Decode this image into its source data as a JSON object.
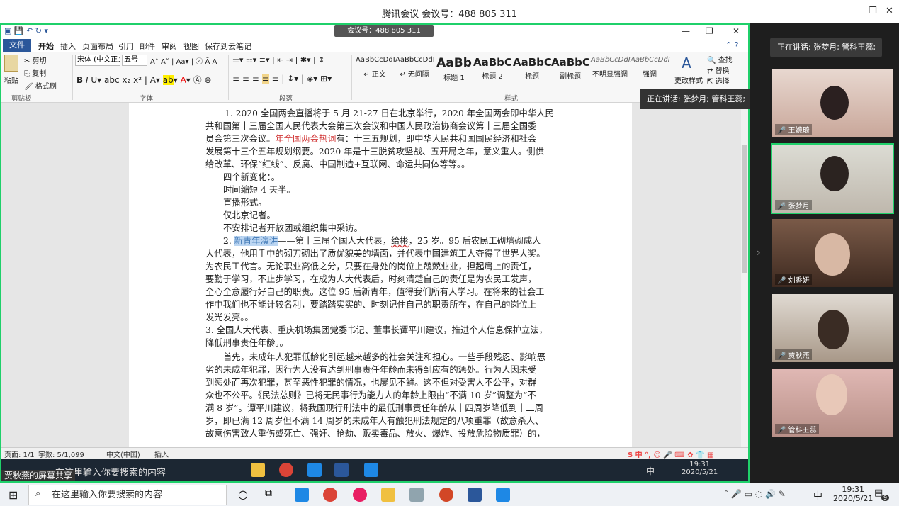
{
  "meeting": {
    "title": "腾讯会议 会议号：488 805 311",
    "float_label": "会议号：488 805 311",
    "speaking": "正在讲话: 张梦月; 管科王蕊;",
    "share_caption": "贾秋燕的屏幕共享"
  },
  "word": {
    "tabs": [
      "文件",
      "开始",
      "插入",
      "页面布局",
      "引用",
      "邮件",
      "审阅",
      "视图",
      "保存到云笔记"
    ],
    "clipboard": {
      "cut": "剪切",
      "copy": "复制",
      "paste": "粘贴",
      "format": "格式刷",
      "group": "剪贴板"
    },
    "font": {
      "name": "宋体 (中文正文)",
      "size": "五号",
      "group": "字体"
    },
    "paragraph_group": "段落",
    "styles_group": "样式",
    "styles": [
      {
        "sample": "AaBbCcDdI",
        "name": "↵ 正文"
      },
      {
        "sample": "AaBbCcDdI",
        "name": "↵ 无间隔"
      },
      {
        "sample": "AaBb",
        "name": "标题 1"
      },
      {
        "sample": "AaBbC",
        "name": "标题 2"
      },
      {
        "sample": "AaBbC",
        "name": "标题"
      },
      {
        "sample": "AaBbC",
        "name": "副标题"
      },
      {
        "sample": "AaBbCcDdI",
        "name": "不明显强调"
      },
      {
        "sample": "AaBbCcDdI",
        "name": "强调"
      }
    ],
    "change_styles": "更改样式",
    "edit": {
      "find": "查找",
      "replace": "替换",
      "select": "选择"
    },
    "status": {
      "page": "页面: 1/1",
      "words": "字数: 5/1,099",
      "lang": "中文(中国)",
      "mode": "插入"
    }
  },
  "doc": {
    "lines": [
      "1.   2020 全国两会直播将于 5 月 21-27 日在北京举行，2020 年全国两会即中华人民",
      "共和国第十三届全国人民代表大会第三次会议和中国人民政治协商会议第十三届全国委",
      "员会第三次会议。",
      "年全国两会热词",
      "有：十三五规划，即中华人民共和国国民经济和社会",
      "发展第十三个五年规划纲要。2020 年是十三脱贫攻坚战、五开局之年，意义重大。侧供",
      "给改革、环保“红线”、反腐、中国制造+互联网、命运共同体等等。。",
      "四个新变化：。",
      "时间缩短 4 天半。",
      "直播形式。",
      "仅北京记者。",
      "不安排记者开放团或组织集中采访。",
      "2.",
      "新青年演讲",
      "——第十三届全国人大代表，",
      "给彬",
      "，25 岁。95 后农民工砌墙砌成人",
      "大代表，他用手中的砌刀砌出了质优貌美的墙面，并代表中国建筑工人夺得了世界大奖。",
      "为农民工代言。无论职业高低之分，只要在身处的岗位上兢兢业业，担起肩上的责任，",
      "要勤于学习，不止步学习，在成为人大代表后，时刻清楚自己的责任是为农民工发声，",
      "全心全意履行好自己的职责。这位 95 后新青年，值得我们所有人学习。在将来的社会工",
      "作中我们也不能计较名利，要踏踏实实的、时刻记住自己的职责所在，在自己的岗位上",
      "发光发亮。。",
      "3. 全国人大代表、重庆机场集团党委书记、董事长谭平川建议，推进个人信息保护立法，",
      "降低刑事责任年龄。。",
      "首先，未成年人犯罪低龄化引起越来越多的社会关注和担心。一些手段残忍、影响恶",
      "劣的未成年犯罪，因行为人没有达到刑事责任年龄而未得到应有的惩处。行为人因未受",
      "到惩处而再次犯罪，甚至恶性犯罪的情况，也屡见不鲜。这不但对受害人不公平，对群",
      "众也不公平。《民法总则》已将无民事行为能力人的年龄上限由“不满 10 岁”调整为“不",
      "满 8 岁”。谭平川建议，将我国现行刑法中的最低刑事责任年龄从十四周岁降低到十二周",
      "岁，即已满 12 周岁但不满 14 周岁的未成年人有触犯刑法规定的八项重罪（故意杀人、",
      "故意伤害致人重伤或死亡、强奸、抢劫、贩卖毒品、放火、爆炸、投放危险物质罪）的，"
    ]
  },
  "participants": [
    {
      "name": "王婉琦"
    },
    {
      "name": "张梦月"
    },
    {
      "name": "刘香妍"
    },
    {
      "name": "贾秋燕"
    },
    {
      "name": "管科王蕊"
    }
  ],
  "remote_taskbar": {
    "search": "在这里输入你要搜索的内容",
    "time": "19:31",
    "date": "2020/5/21",
    "ime": "中"
  },
  "taskbar": {
    "search": "在这里输入你要搜索的内容",
    "time": "19:31",
    "date": "2020/5/21",
    "ime": "中",
    "badge": "9"
  }
}
